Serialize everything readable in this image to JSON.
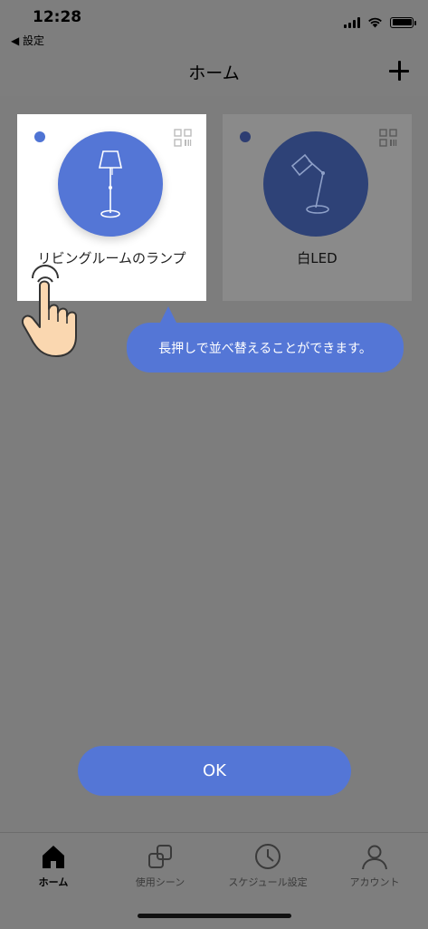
{
  "status_bar": {
    "time": "12:28",
    "back_app": "◀ 設定"
  },
  "nav": {
    "title": "ホーム",
    "add_icon": "plus-icon"
  },
  "devices": [
    {
      "name": "リビングルームのランプ",
      "icon": "floor-lamp-icon",
      "status_color": "#4f74d4",
      "highlighted": true
    },
    {
      "name": "白LED",
      "icon": "desk-lamp-icon",
      "status_color": "#2d3d72",
      "highlighted": false
    }
  ],
  "tooltip": {
    "text": "長押しで並べ替えることができます。"
  },
  "ok_button": {
    "label": "OK"
  },
  "tabs": [
    {
      "label": "ホーム",
      "icon": "home-icon",
      "active": true
    },
    {
      "label": "使用シーン",
      "icon": "scenes-icon",
      "active": false
    },
    {
      "label": "スケジュール設定",
      "icon": "clock-icon",
      "active": false
    },
    {
      "label": "アカウント",
      "icon": "account-icon",
      "active": false
    }
  ],
  "colors": {
    "accent": "#5476d6",
    "overlay": "#7d7d7d",
    "card_highlight": "#ffffff"
  }
}
